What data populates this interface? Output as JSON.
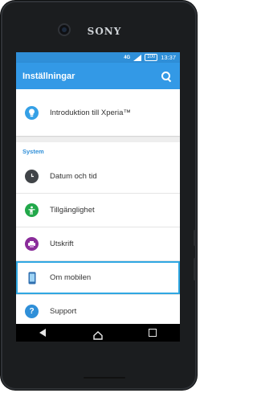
{
  "device": {
    "brand": "SONY"
  },
  "status_bar": {
    "network": "4G",
    "battery": "100",
    "time": "13:37"
  },
  "app_bar": {
    "title": "Inställningar"
  },
  "items_top": [
    {
      "label": "Introduktion till Xperia™",
      "icon": "lightbulb-icon"
    }
  ],
  "section": {
    "title": "System"
  },
  "system_items": [
    {
      "label": "Datum och tid",
      "icon": "clock-icon"
    },
    {
      "label": "Tillgänglighet",
      "icon": "accessibility-icon"
    },
    {
      "label": "Utskrift",
      "icon": "printer-icon"
    },
    {
      "label": "Om mobilen",
      "icon": "phone-icon",
      "selected": true
    },
    {
      "label": "Support",
      "icon": "help-icon"
    }
  ],
  "colors": {
    "accent": "#3399e6",
    "status_bar": "#2f8fd8",
    "selected_outline": "#2fa7e2"
  }
}
